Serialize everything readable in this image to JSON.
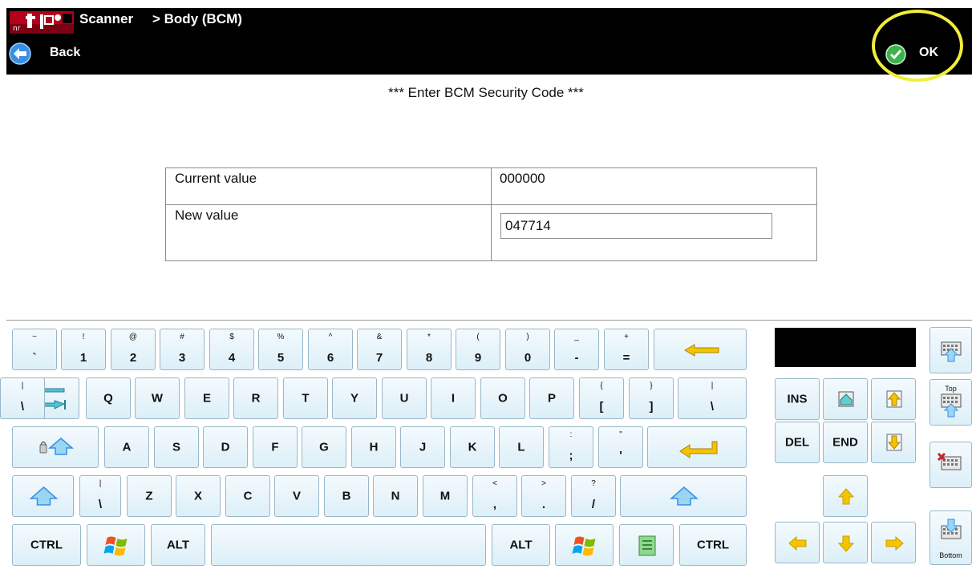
{
  "header": {
    "app_name": "Scanner",
    "breadcrumb": "> Body (BCM)",
    "back_label": "Back",
    "ok_label": "OK"
  },
  "prompt": "*** Enter BCM Security Code ***",
  "value_table": {
    "current_label": "Current value",
    "current_value": "000000",
    "new_label": "New value",
    "new_value": "047714"
  },
  "keyboard": {
    "row1": [
      {
        "top": "~",
        "bot": "`"
      },
      {
        "top": "!",
        "bot": "1"
      },
      {
        "top": "@",
        "bot": "2"
      },
      {
        "top": "#",
        "bot": "3"
      },
      {
        "top": "$",
        "bot": "4"
      },
      {
        "top": "%",
        "bot": "5"
      },
      {
        "top": "^",
        "bot": "6"
      },
      {
        "top": "&",
        "bot": "7"
      },
      {
        "top": "*",
        "bot": "8"
      },
      {
        "top": "(",
        "bot": "9"
      },
      {
        "top": ")",
        "bot": "0"
      },
      {
        "top": "_",
        "bot": "-"
      },
      {
        "top": "+",
        "bot": "="
      }
    ],
    "row2": [
      "Q",
      "W",
      "E",
      "R",
      "T",
      "Y",
      "U",
      "I",
      "O",
      "P"
    ],
    "row2_sym": [
      {
        "top": "{",
        "bot": "["
      },
      {
        "top": "}",
        "bot": "]"
      },
      {
        "top": "|",
        "bot": "\\"
      }
    ],
    "row3": [
      "A",
      "S",
      "D",
      "F",
      "G",
      "H",
      "J",
      "K",
      "L"
    ],
    "row3_sym": [
      {
        "top": ":",
        "bot": ";"
      },
      {
        "top": "\"",
        "bot": "'"
      }
    ],
    "row4_pre": {
      "top": "|",
      "bot": "\\"
    },
    "row4": [
      "Z",
      "X",
      "C",
      "V",
      "B",
      "N",
      "M"
    ],
    "row4_sym": [
      {
        "top": "<",
        "bot": ","
      },
      {
        "top": ">",
        "bot": "."
      },
      {
        "top": "?",
        "bot": "/"
      }
    ],
    "ctrl": "CTRL",
    "alt": "ALT",
    "ins": "INS",
    "del": "DEL",
    "end": "END",
    "top_label": "Top",
    "bottom_label": "Bottom"
  },
  "colors": {
    "header_bg": "#000000",
    "key_border": "#98b7c9",
    "highlight": "#f1ee3a",
    "arrow_yellow": "#f5c400"
  }
}
